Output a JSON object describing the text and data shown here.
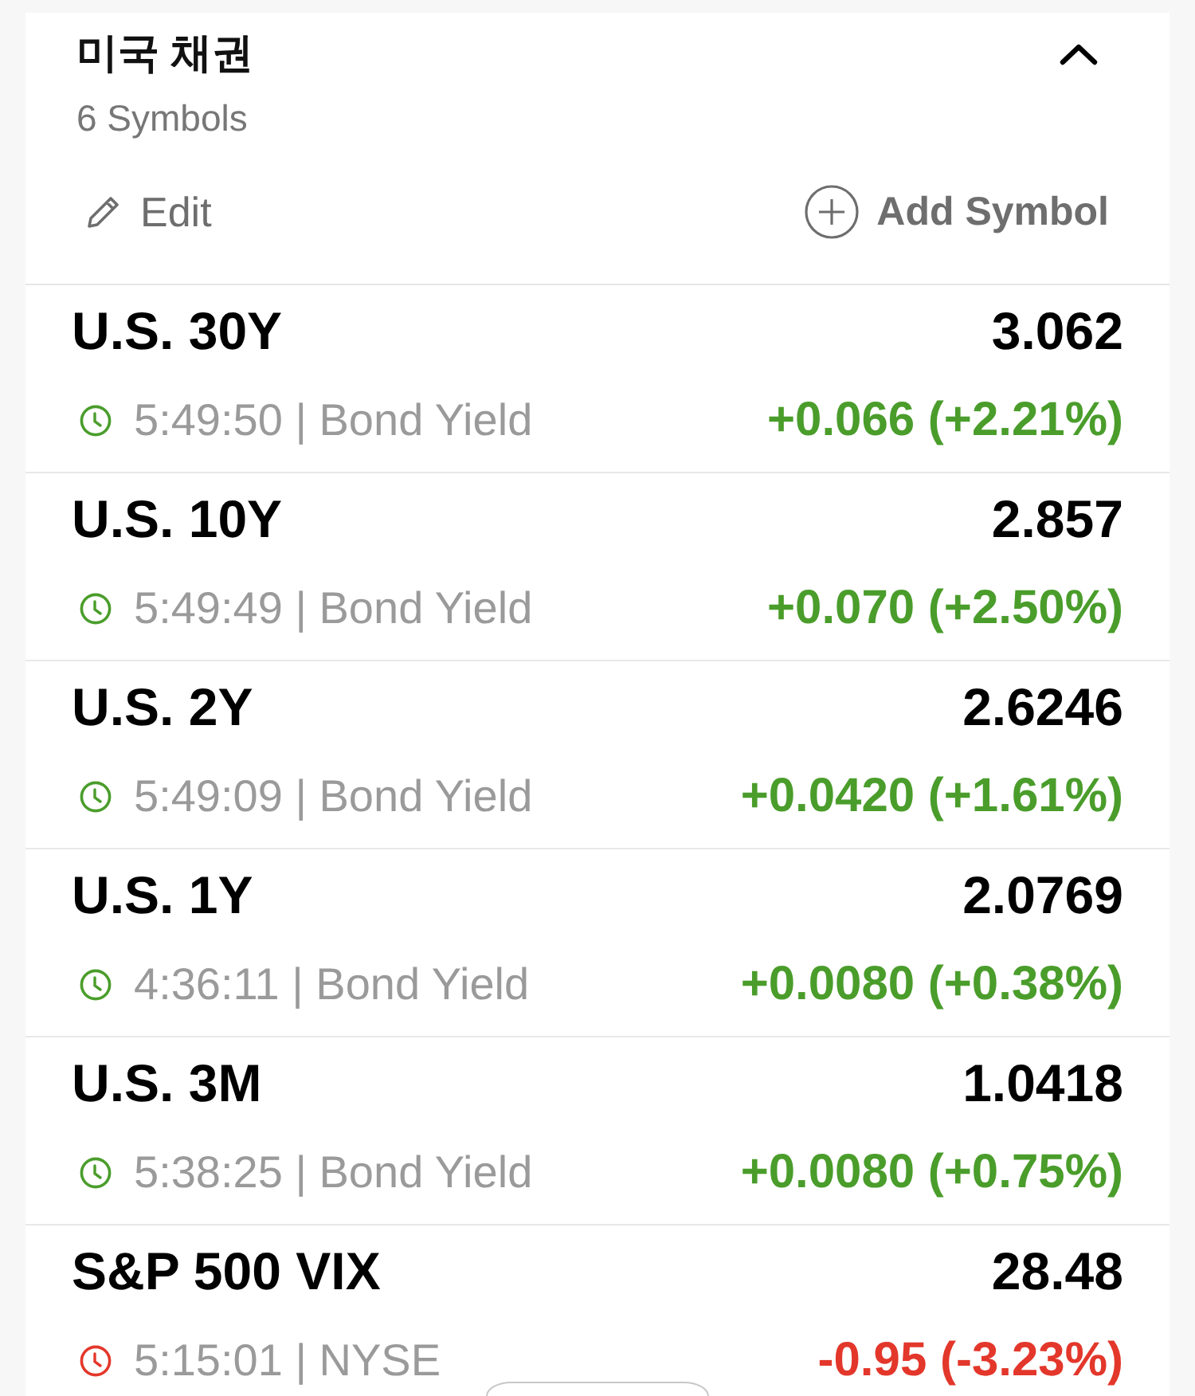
{
  "header": {
    "title": "미국 채권",
    "subtitle": "6 Symbols",
    "expanded": true
  },
  "actions": [
    {
      "kind": "edit",
      "label": "Edit"
    },
    {
      "kind": "add",
      "label": "Add Symbol"
    }
  ],
  "rows": [
    {
      "name": "U.S. 30Y",
      "price": "3.062",
      "meta": "5:49:50 | Bond Yield",
      "change": "+0.066 (+2.21%)",
      "color": "#4a9d2b"
    },
    {
      "name": "U.S. 10Y",
      "price": "2.857",
      "meta": "5:49:49 | Bond Yield",
      "change": "+0.070 (+2.50%)",
      "color": "#4a9d2b"
    },
    {
      "name": "U.S. 2Y",
      "price": "2.6246",
      "meta": "5:49:09 | Bond Yield",
      "change": "+0.0420 (+1.61%)",
      "color": "#4a9d2b"
    },
    {
      "name": "U.S. 1Y",
      "price": "2.0769",
      "meta": "4:36:11 | Bond Yield",
      "change": "+0.0080 (+0.38%)",
      "color": "#4a9d2b"
    },
    {
      "name": "U.S. 3M",
      "price": "1.0418",
      "meta": "5:38:25 | Bond Yield",
      "change": "+0.0080 (+0.75%)",
      "color": "#4a9d2b"
    },
    {
      "name": "S&P 500 VIX",
      "price": "28.48",
      "meta": "5:15:01 | NYSE",
      "change": "-0.95 (-3.23%)",
      "color": "#e3372b"
    }
  ]
}
